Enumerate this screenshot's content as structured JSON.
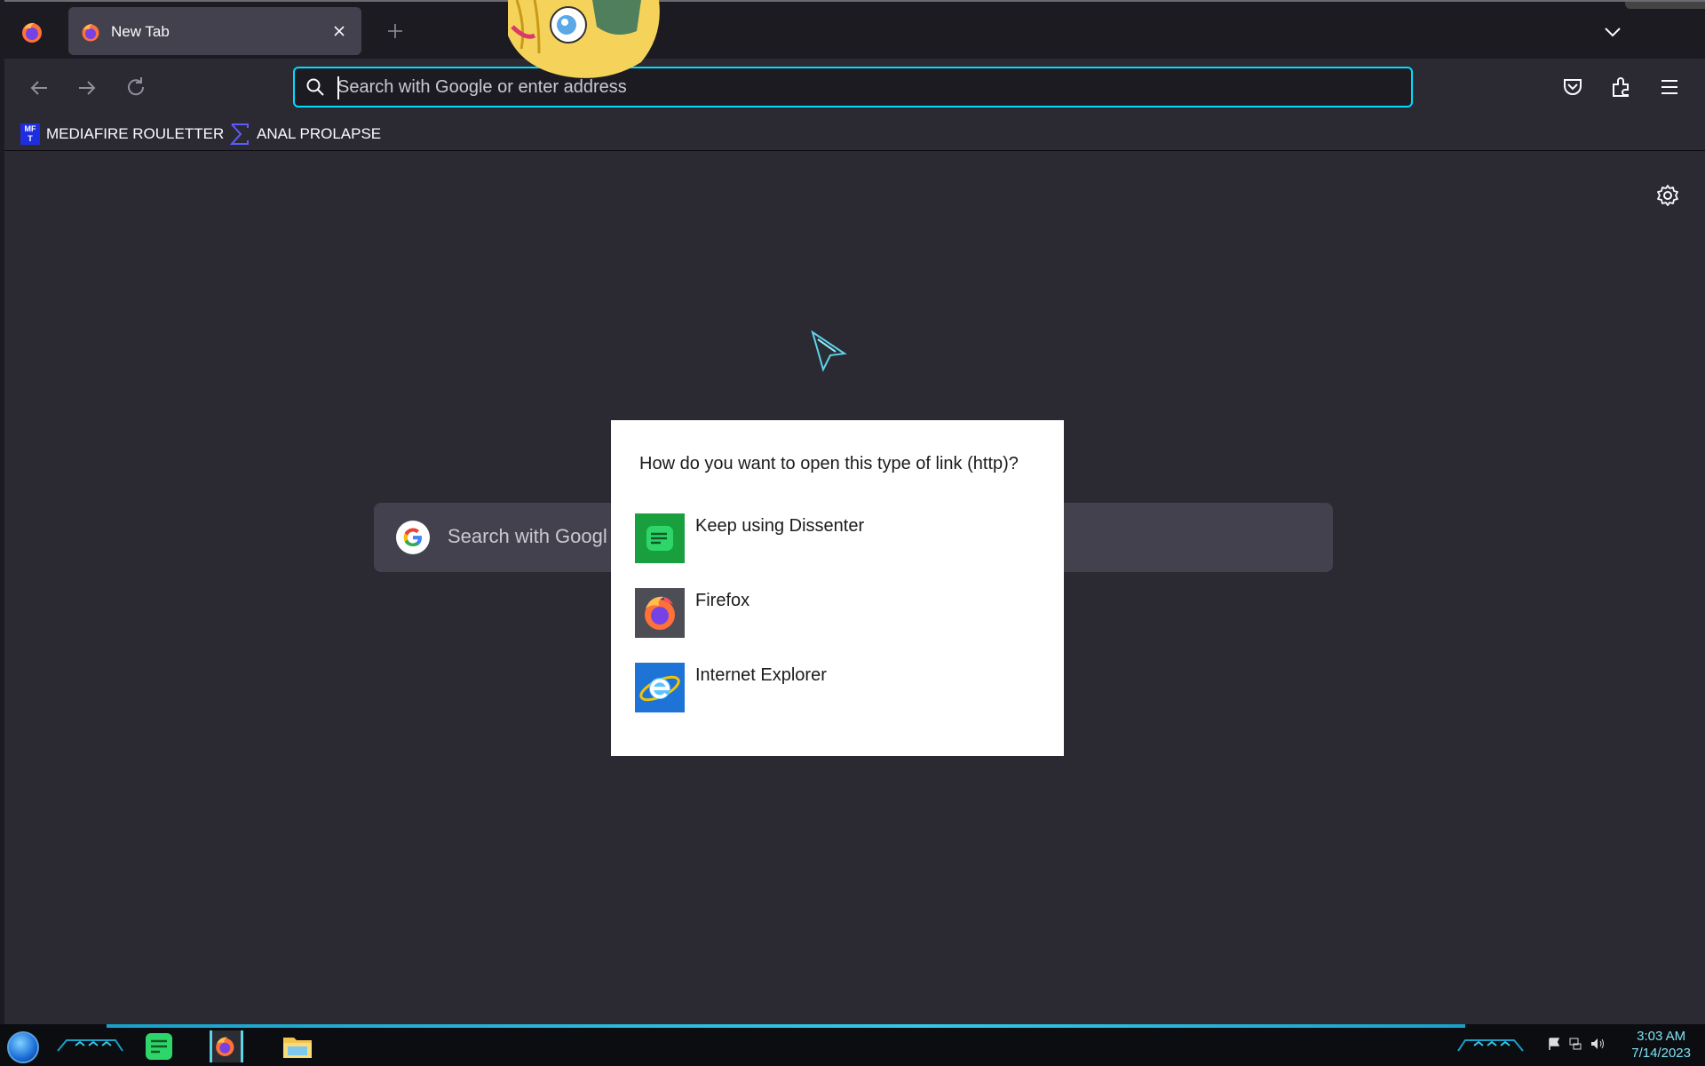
{
  "browser": {
    "tab": {
      "title": "New Tab"
    },
    "urlbar": {
      "placeholder": "Search with Google or enter address"
    },
    "bookmarks": [
      {
        "label": "MEDIAFIRE ROULETTER",
        "icon": "mediafire-icon",
        "icon_text": "MF\nT"
      },
      {
        "label": "ANAL PROLAPSE",
        "icon": "sigma-icon"
      }
    ],
    "colors": {
      "accent": "#00ddff",
      "chrome": "#2b2a33",
      "tabstrip": "#1c1b22"
    }
  },
  "newtab": {
    "search_placeholder": "Search with Googl"
  },
  "dialog": {
    "title": "How do you want to open this type of link (http)?",
    "options": [
      {
        "label": "Keep using Dissenter",
        "icon": "dissenter-icon",
        "color": "#1a9f3f"
      },
      {
        "label": "Firefox",
        "icon": "firefox-icon",
        "color": "#4d4d56"
      },
      {
        "label": "Internet Explorer",
        "icon": "internet-explorer-icon",
        "color": "#1e73d6"
      }
    ]
  },
  "taskbar": {
    "apps": [
      "dissenter-icon",
      "firefox-icon",
      "file-explorer-icon"
    ],
    "tray": [
      "flag-icon",
      "network-icon",
      "volume-icon"
    ],
    "clock": {
      "time": "3:03 AM",
      "date": "7/14/2023"
    }
  }
}
